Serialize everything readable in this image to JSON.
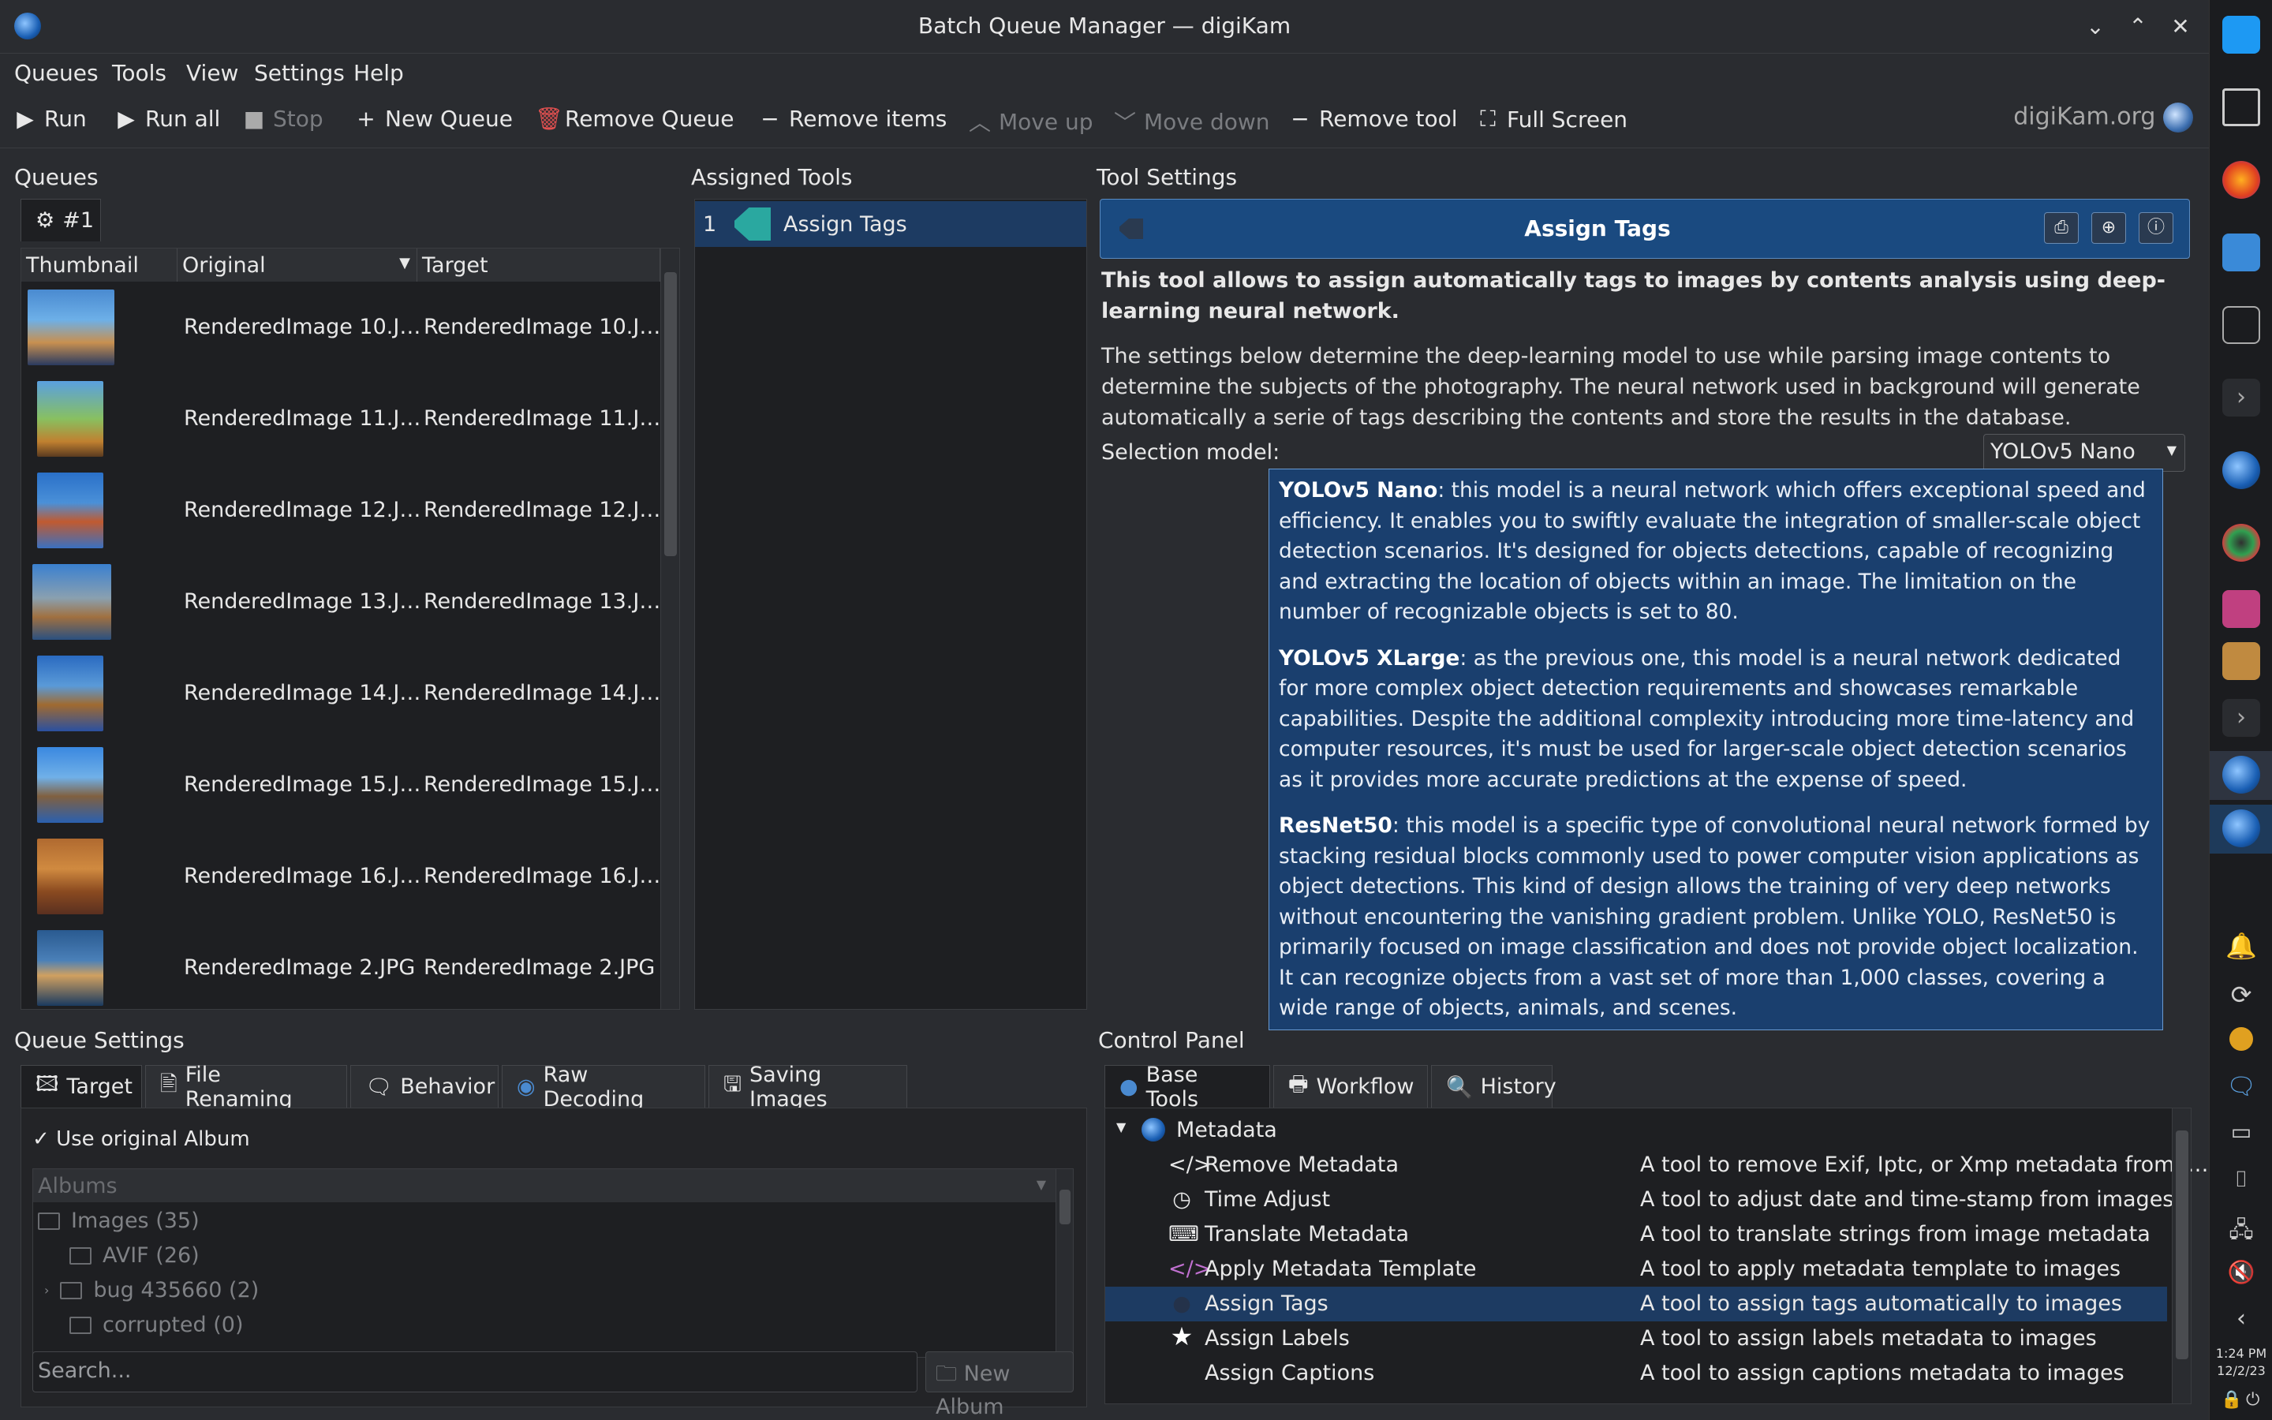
{
  "window": {
    "title": "Batch Queue Manager — digiKam",
    "controls": [
      "⌄",
      "⌃",
      "✕"
    ]
  },
  "menubar": {
    "items": [
      "Queues",
      "Tools",
      "View",
      "Settings",
      "Help"
    ]
  },
  "toolbar": {
    "run": "Run",
    "run_all": "Run all",
    "stop": "Stop",
    "new_queue": "New Queue",
    "remove_queue": "Remove Queue",
    "remove_items": "Remove items",
    "move_up": "Move up",
    "move_down": "Move down",
    "remove_tool": "Remove tool",
    "full_screen": "Full Screen",
    "brand": "digiKam.org"
  },
  "queues": {
    "label": "Queues",
    "tab": "#1",
    "columns": [
      "Thumbnail",
      "Original",
      "Target"
    ],
    "rows": [
      {
        "original": "RenderedImage 10.J…",
        "target": "RenderedImage 10.J…"
      },
      {
        "original": "RenderedImage 11.J…",
        "target": "RenderedImage 11.J…"
      },
      {
        "original": "RenderedImage 12.J…",
        "target": "RenderedImage 12.J…"
      },
      {
        "original": "RenderedImage 13.J…",
        "target": "RenderedImage 13.J…"
      },
      {
        "original": "RenderedImage 14.J…",
        "target": "RenderedImage 14.J…"
      },
      {
        "original": "RenderedImage 15.J…",
        "target": "RenderedImage 15.J…"
      },
      {
        "original": "RenderedImage 16.J…",
        "target": "RenderedImage 16.J…"
      },
      {
        "original": "RenderedImage 2.JPG",
        "target": "RenderedImage 2.JPG"
      }
    ]
  },
  "assigned_tools": {
    "label": "Assigned Tools",
    "items": [
      {
        "index": "1",
        "name": "Assign Tags"
      }
    ]
  },
  "tool_settings": {
    "label": "Tool Settings",
    "header": "Assign Tags",
    "intro": "This tool allows to assign automatically tags to images by contents analysis using deep-learning neural network.",
    "description": "The settings below determine the deep-learning model to use while parsing image contents to determine the subjects of the photography. The neural network used in background will generate automatically a serie of tags describing the contents and store the results in the database.",
    "selection_label": "Selection model:",
    "selection_value": "YOLOv5 Nano"
  },
  "tooltip": {
    "p1_bold": "YOLOv5 Nano",
    "p1": ": this model is a neural network which offers exceptional speed and efficiency. It enables you to swiftly evaluate the integration of smaller-scale object detection scenarios. It's designed for objects detections, capable of recognizing and extracting the location of objects within an image. The limitation on the number of recognizable objects is set to 80.",
    "p2_bold": "YOLOv5 XLarge",
    "p2": ": as the previous one, this model is a neural network dedicated for more complex object detection requirements and showcases remarkable capabilities. Despite the additional complexity introducing more time-latency and computer resources, it's must be used for larger-scale object detection scenarios as it provides more accurate predictions at the expense of speed.",
    "p3_bold": "ResNet50",
    "p3": ": this model is a specific type of convolutional neural network formed by stacking residual blocks commonly used to power computer vision applications as object detections. This kind of design allows the training of very deep networks without encountering the vanishing gradient problem. Unlike YOLO, ResNet50 is primarily focused on image classification and does not provide object localization. It can recognize objects from a vast set of more than 1,000 classes, covering a wide range of objects, animals, and scenes."
  },
  "queue_settings": {
    "label": "Queue Settings",
    "tabs": [
      "Target",
      "File Renaming",
      "Behavior",
      "Raw Decoding",
      "Saving Images"
    ],
    "use_original": "Use original Album",
    "albums_header": "Albums",
    "tree": [
      "Images (35)",
      "AVIF (26)",
      "bug 435660 (2)",
      "corrupted (0)"
    ],
    "search_placeholder": "Search...",
    "new_album": "New Album"
  },
  "control_panel": {
    "label": "Control Panel",
    "tabs": [
      "Base Tools",
      "Workflow",
      "History"
    ],
    "group": "Metadata",
    "tools": [
      {
        "name": "Remove Metadata",
        "desc": "A tool to remove Exif, Iptc, or Xmp metadata from i…",
        "icon": "</>"
      },
      {
        "name": "Time Adjust",
        "desc": "A tool to adjust date and time-stamp from images",
        "icon": "◷"
      },
      {
        "name": "Translate Metadata",
        "desc": "A tool to translate strings from image metadata",
        "icon": "⌨"
      },
      {
        "name": "Apply Metadata Template",
        "desc": "A tool to apply metadata template to images",
        "icon": "</>"
      },
      {
        "name": "Assign Tags",
        "desc": "A tool to assign tags automatically to images",
        "icon": "●"
      },
      {
        "name": "Assign Labels",
        "desc": "A tool to assign labels metadata to images",
        "icon": "★"
      },
      {
        "name": "Assign Captions",
        "desc": "A tool to assign captions metadata to images",
        "icon": " "
      }
    ]
  },
  "clock": {
    "time": "1:24 PM",
    "date": "12/2/23"
  },
  "colors": {
    "accent": "#1a4a80",
    "selected": "#1d3b62",
    "tooltip": "#1a3f6e"
  }
}
